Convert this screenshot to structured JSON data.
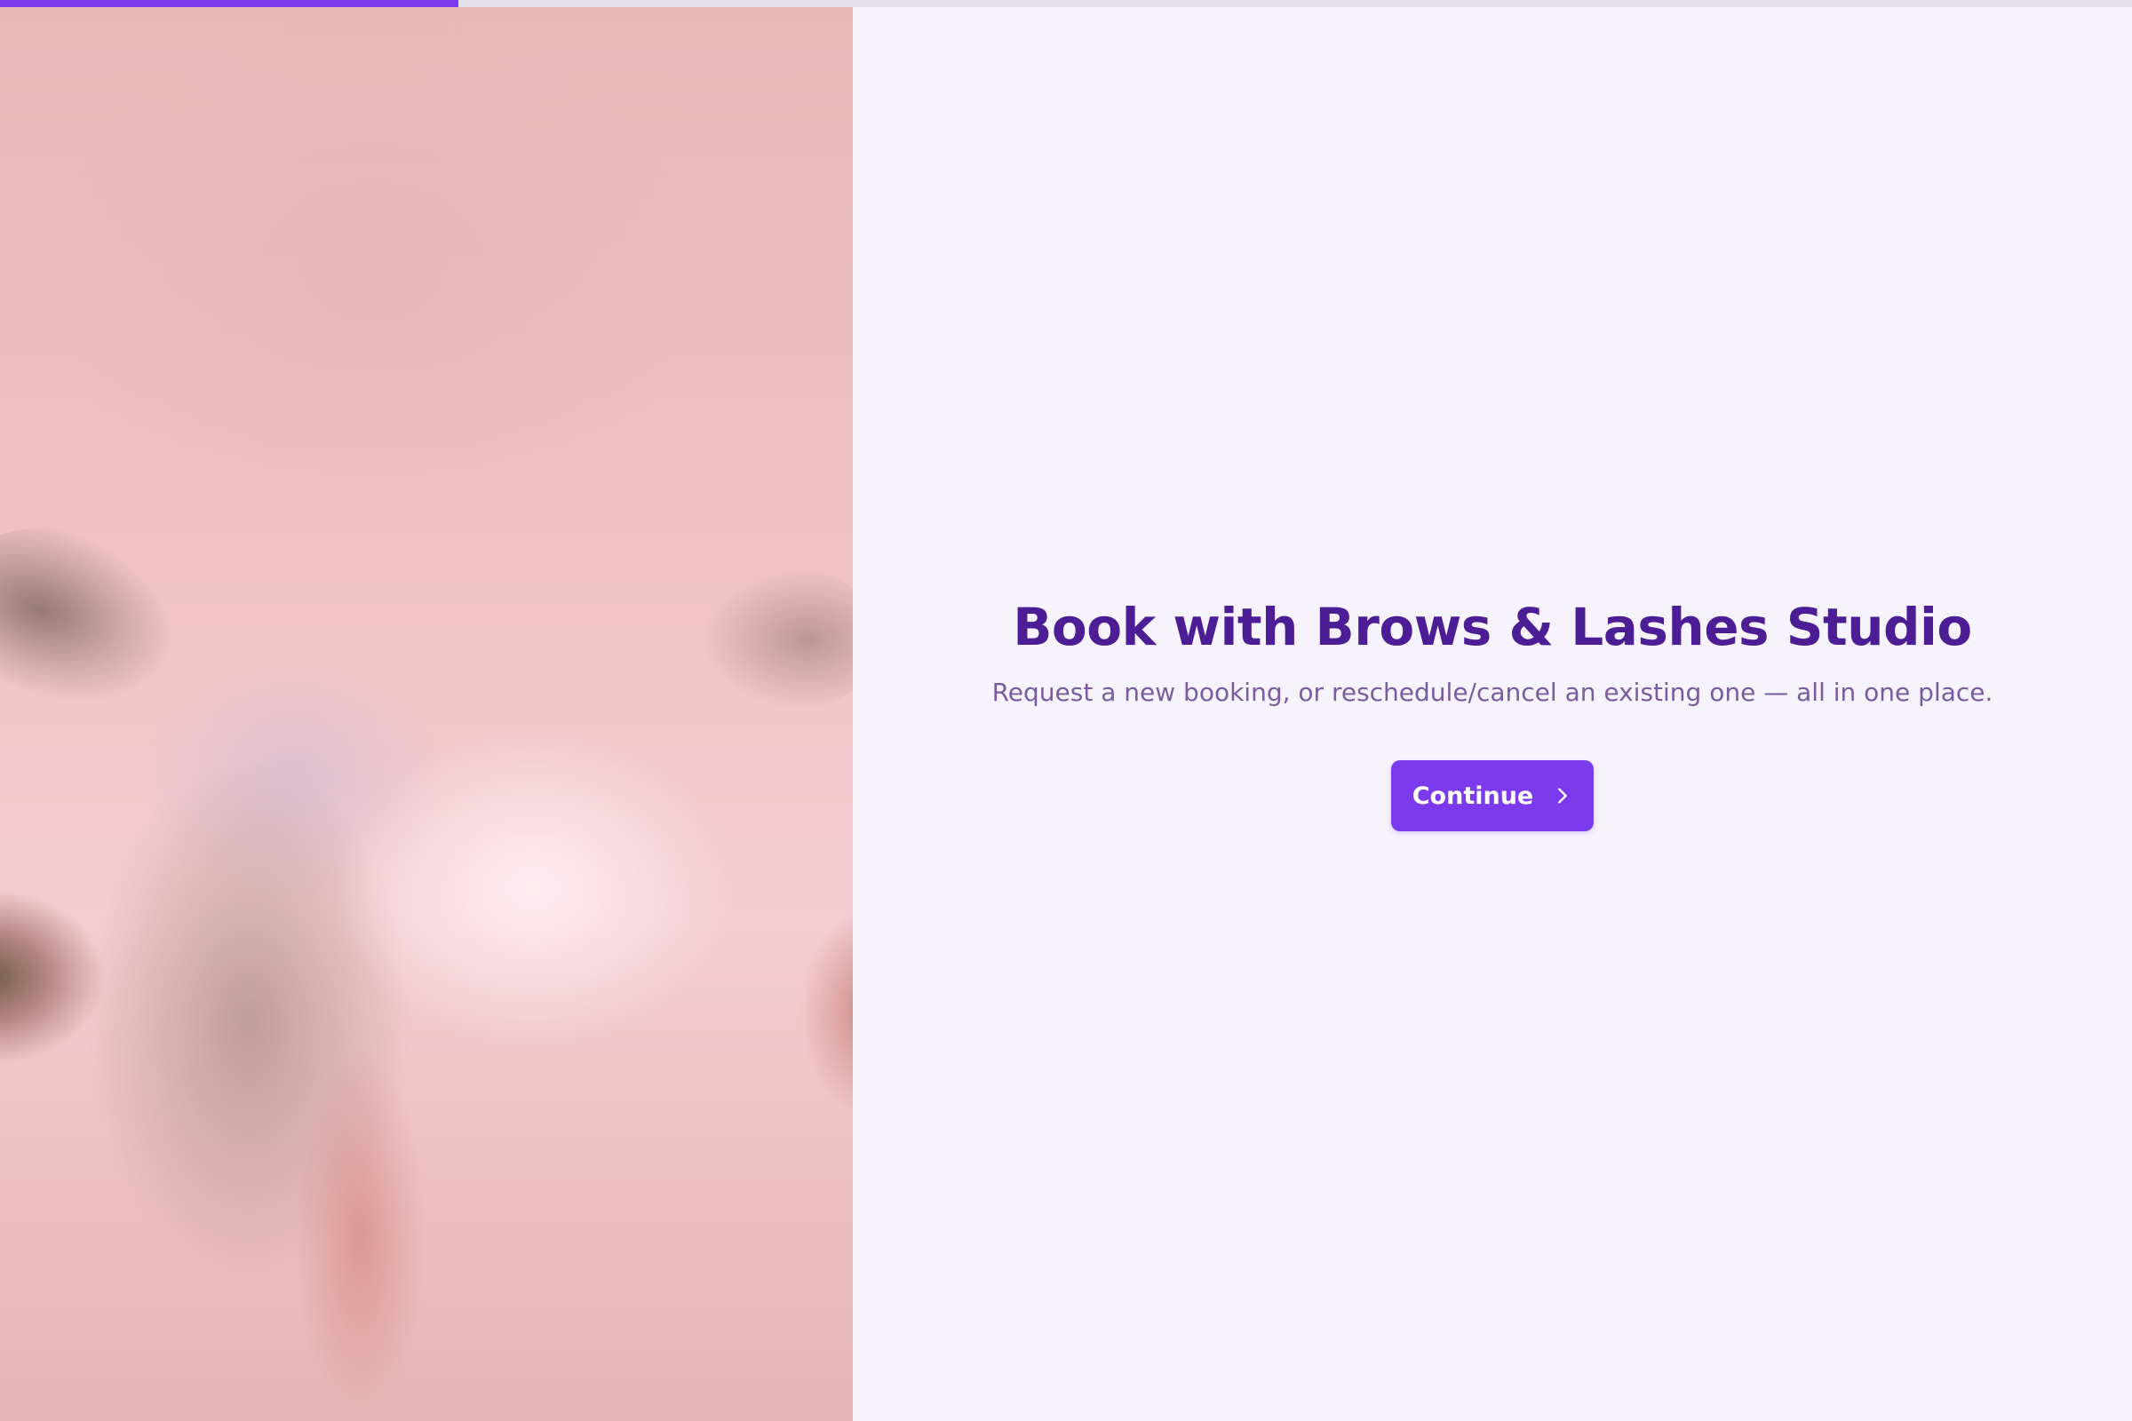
{
  "progress": {
    "fraction": 0.215,
    "fill_color": "#7c3aed",
    "track_color": "#e4e0ea"
  },
  "hero": {
    "image_icon": "face-closeup-photo"
  },
  "main": {
    "title": "Book with Brows & Lashes Studio",
    "subtitle": "Request a new booking, or reschedule/cancel an existing one — all in one place.",
    "continue_label": "Continue",
    "continue_icon": "chevron-right-icon"
  },
  "colors": {
    "accent": "#7c3aed",
    "title": "#4c1d95",
    "subtitle": "#7a5b9e",
    "background": "#f6f3fd"
  }
}
